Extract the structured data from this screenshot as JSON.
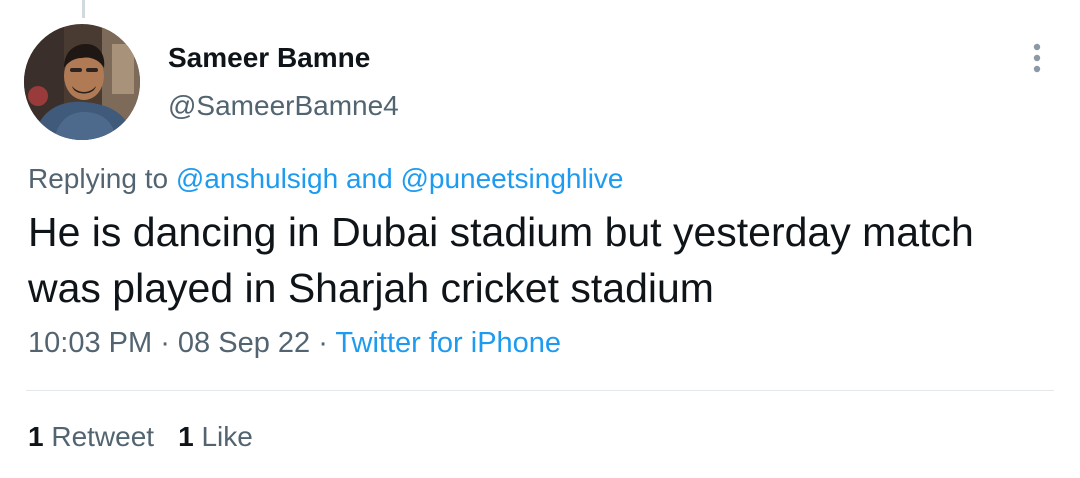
{
  "tweet": {
    "author": {
      "name": "Sameer Bamne",
      "handle": "@SameerBamne4"
    },
    "more_icon": "vertical-ellipsis-icon",
    "reply_context": {
      "prefix": "Replying to ",
      "mention_1": "@anshulsigh",
      "conjunction": " and ",
      "mention_2": "@puneetsinghlive"
    },
    "text": "He is dancing in Dubai stadium but yesterday match was played in Sharjah cricket stadium",
    "time": "10:03 PM",
    "separator_1": " · ",
    "date": "08 Sep 22",
    "separator_2": " · ",
    "source": "Twitter for iPhone",
    "stats": {
      "retweet_count": "1",
      "retweet_label": "Retweet",
      "like_count": "1",
      "like_label": "Like"
    }
  },
  "colors": {
    "text_primary": "#0f1419",
    "text_secondary": "#536471",
    "accent": "#1d9bf0",
    "divider": "#e5e8eb",
    "thread_line": "#cfd9de"
  }
}
